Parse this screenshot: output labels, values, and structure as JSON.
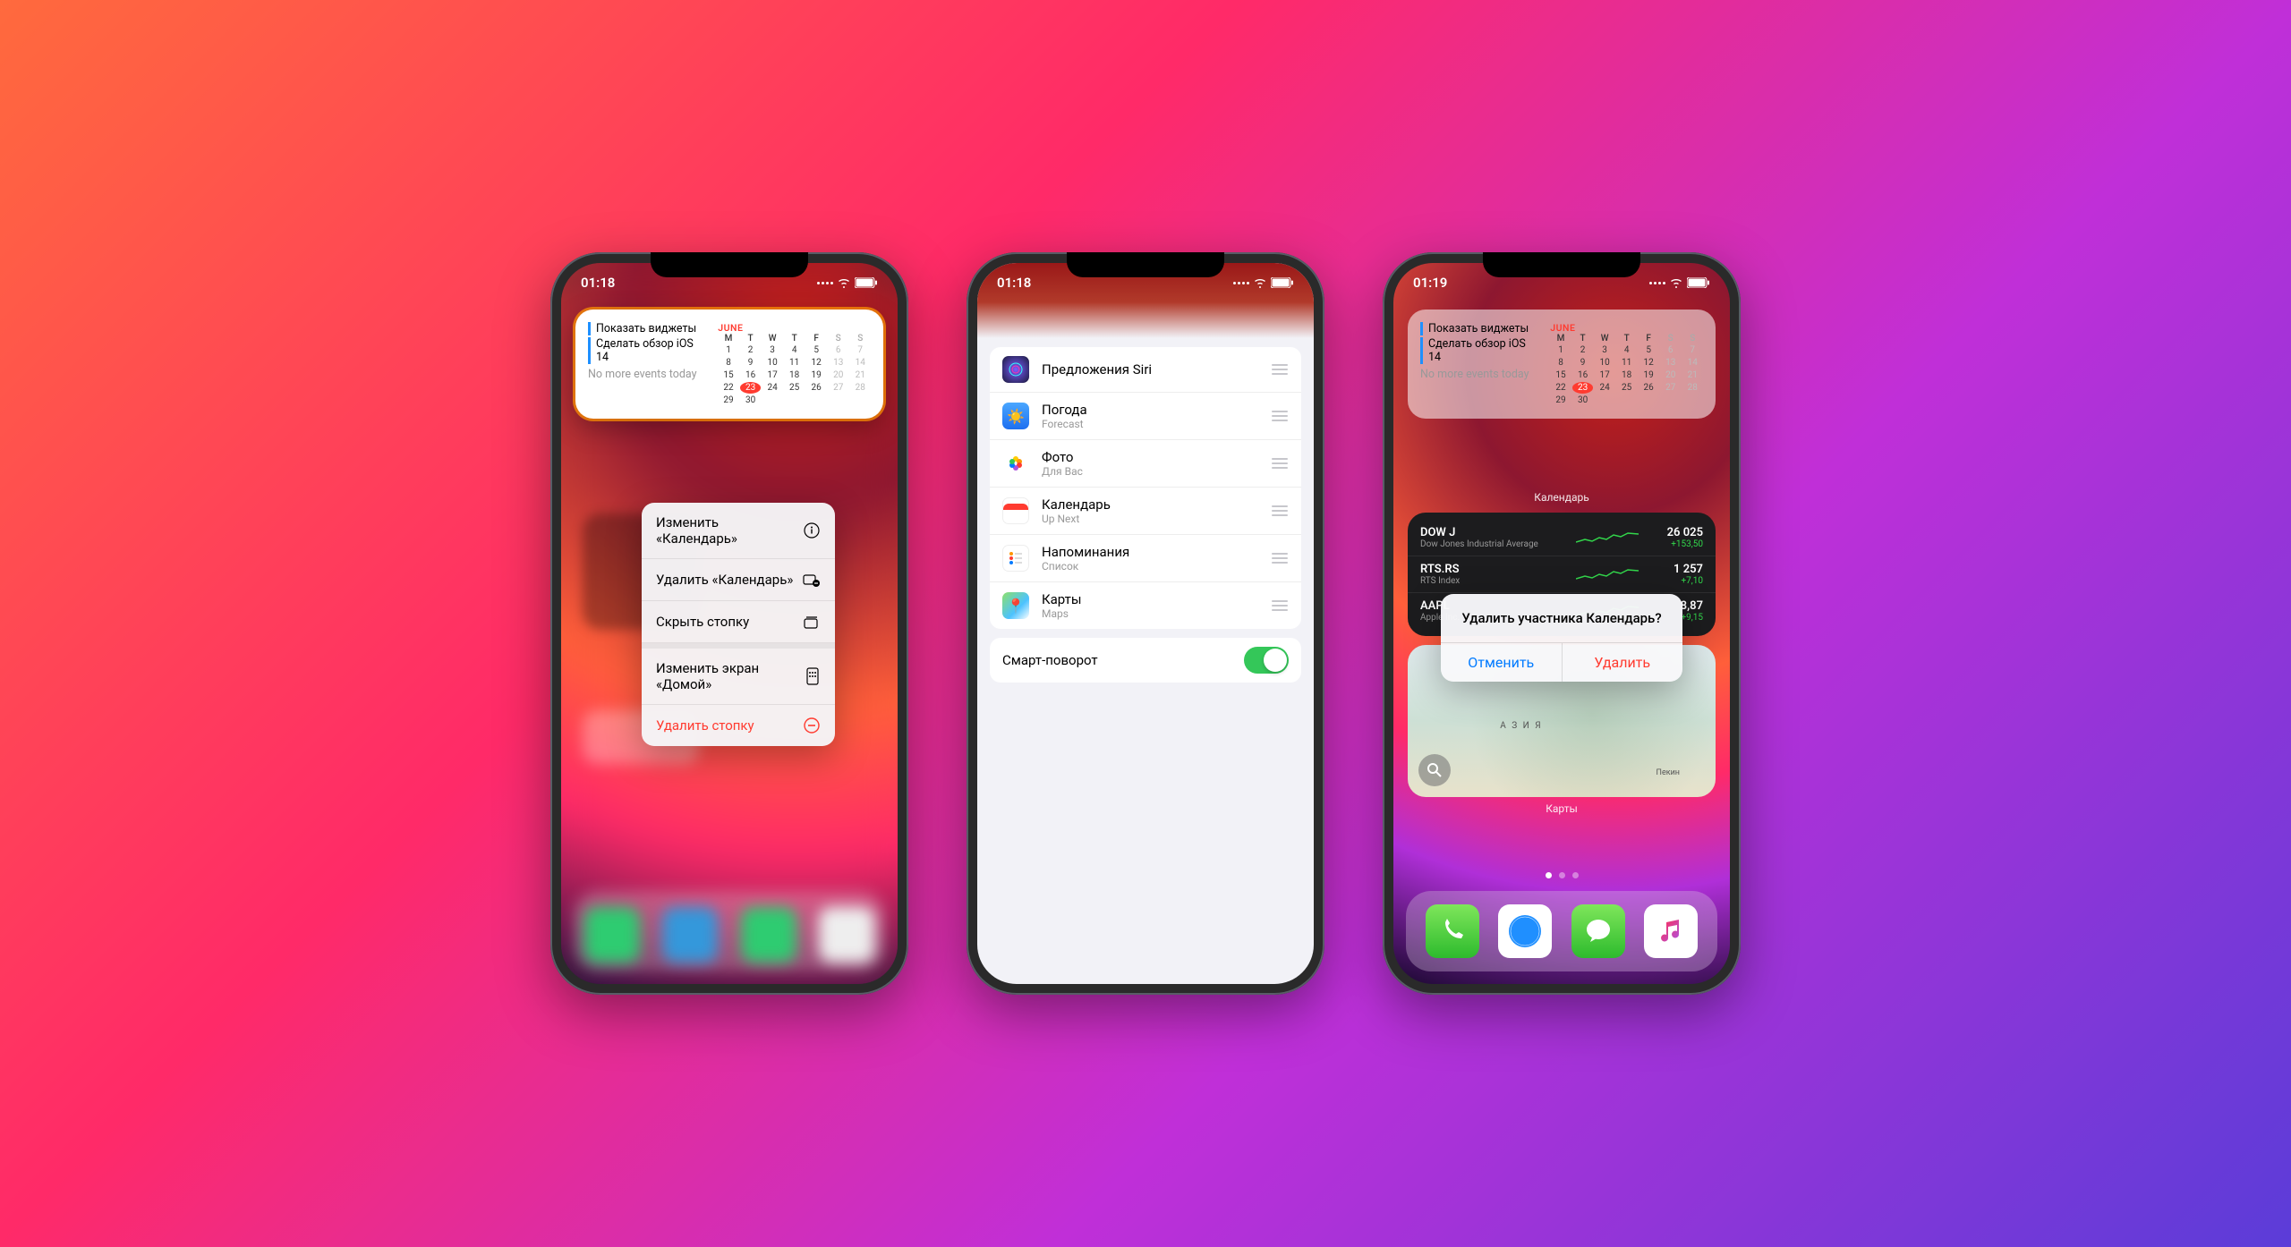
{
  "status": {
    "time1": "01:18",
    "time2": "01:18",
    "time3": "01:19"
  },
  "calendar": {
    "events": [
      "Показать виджеты",
      "Сделать обзор iOS 14"
    ],
    "noMore": "No more events today",
    "month": "JUNE",
    "dow": [
      "M",
      "T",
      "W",
      "T",
      "F",
      "S",
      "S"
    ],
    "days": [
      1,
      2,
      3,
      4,
      5,
      6,
      7,
      8,
      9,
      10,
      11,
      12,
      13,
      14,
      15,
      16,
      17,
      18,
      19,
      20,
      21,
      22,
      23,
      24,
      25,
      26,
      27,
      28,
      29,
      30
    ],
    "today": 23,
    "label": "Календарь"
  },
  "ctx": {
    "edit": "Изменить «Календарь»",
    "remove": "Удалить «Календарь»",
    "hide": "Скрыть стопку",
    "editHome": "Изменить экран «Домой»",
    "deleteStack": "Удалить стопку"
  },
  "stack": {
    "siri": {
      "title": "Предложения Siri"
    },
    "weather": {
      "title": "Погода",
      "sub": "Forecast"
    },
    "photos": {
      "title": "Фото",
      "sub": "Для Вас"
    },
    "cal": {
      "title": "Календарь",
      "sub": "Up Next"
    },
    "reminders": {
      "title": "Напоминания",
      "sub": "Список"
    },
    "maps": {
      "title": "Карты",
      "sub": "Maps"
    },
    "smartRotate": "Смарт-поворот"
  },
  "stocks": [
    {
      "sym": "DOW J",
      "name": "Dow Jones Industrial Average",
      "price": "26 025",
      "change": "+153,50"
    },
    {
      "sym": "RTS.RS",
      "name": "RTS Index",
      "price": "1 257",
      "change": "+7,10"
    },
    {
      "sym": "AAPL",
      "name": "Apple Inc.",
      "price": "8,87",
      "change": "+9,15"
    }
  ],
  "alert": {
    "title": "Удалить участника Календарь?",
    "cancel": "Отменить",
    "confirm": "Удалить"
  },
  "maps": {
    "label": "Карты",
    "asia": "А З И Я",
    "beijing": "Пекин"
  }
}
